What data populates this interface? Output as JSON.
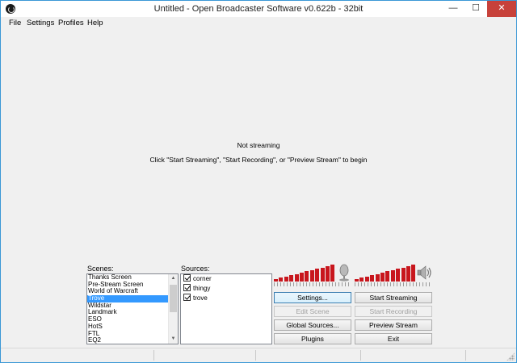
{
  "window": {
    "title": "Untitled - Open Broadcaster Software v0.622b - 32bit",
    "minimize_glyph": "—",
    "maximize_glyph": "☐",
    "close_glyph": "✕"
  },
  "menu": {
    "items": [
      {
        "label": "File"
      },
      {
        "label": "Settings"
      },
      {
        "label": "Profiles"
      },
      {
        "label": "Help"
      }
    ]
  },
  "preview": {
    "status": "Not streaming",
    "hint": "Click \"Start Streaming\", \"Start Recording\", or \"Preview Stream\" to begin"
  },
  "scenes": {
    "label": "Scenes:",
    "items": [
      "Thanks Screen",
      "Pre-Stream Screen",
      "World of Warcraft",
      "Trove",
      "Wildstar",
      "Landmark",
      "ESO",
      "HotS",
      "FTL",
      "EQ2"
    ],
    "selected": "Trove"
  },
  "sources": {
    "label": "Sources:",
    "items": [
      {
        "label": "corner",
        "checked": true
      },
      {
        "label": "thingy",
        "checked": true
      },
      {
        "label": "trove",
        "checked": true
      }
    ]
  },
  "audio": {
    "mic_icon": "microphone-icon",
    "speaker_icon": "speaker-icon",
    "meter_color": "#c8161d"
  },
  "buttons": {
    "settings": "Settings...",
    "start_streaming": "Start Streaming",
    "edit_scene": "Edit Scene",
    "start_recording": "Start Recording",
    "global_sources": "Global Sources...",
    "preview_stream": "Preview Stream",
    "plugins": "Plugins",
    "exit": "Exit"
  }
}
